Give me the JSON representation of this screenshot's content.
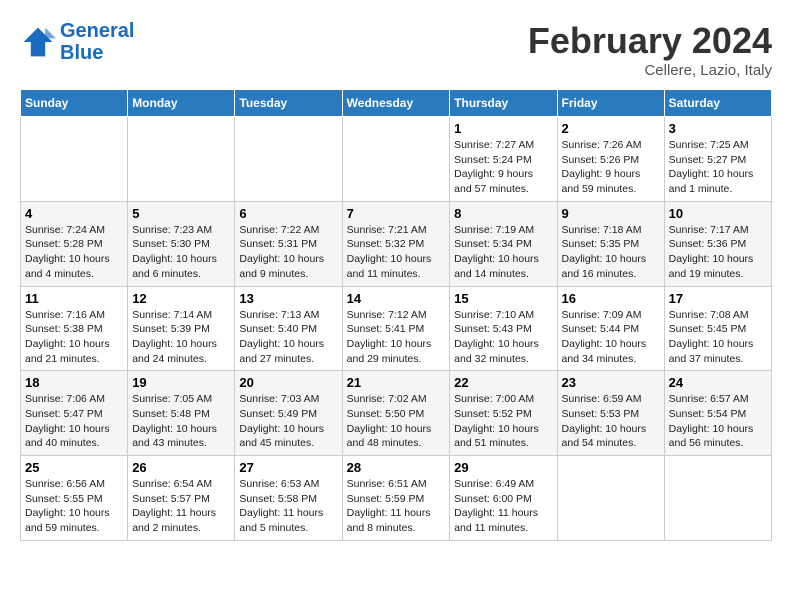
{
  "header": {
    "logo_line1": "General",
    "logo_line2": "Blue",
    "month": "February 2024",
    "location": "Cellere, Lazio, Italy"
  },
  "weekdays": [
    "Sunday",
    "Monday",
    "Tuesday",
    "Wednesday",
    "Thursday",
    "Friday",
    "Saturday"
  ],
  "weeks": [
    [
      {
        "day": "",
        "info": ""
      },
      {
        "day": "",
        "info": ""
      },
      {
        "day": "",
        "info": ""
      },
      {
        "day": "",
        "info": ""
      },
      {
        "day": "1",
        "info": "Sunrise: 7:27 AM\nSunset: 5:24 PM\nDaylight: 9 hours and 57 minutes."
      },
      {
        "day": "2",
        "info": "Sunrise: 7:26 AM\nSunset: 5:26 PM\nDaylight: 9 hours and 59 minutes."
      },
      {
        "day": "3",
        "info": "Sunrise: 7:25 AM\nSunset: 5:27 PM\nDaylight: 10 hours and 1 minute."
      }
    ],
    [
      {
        "day": "4",
        "info": "Sunrise: 7:24 AM\nSunset: 5:28 PM\nDaylight: 10 hours and 4 minutes."
      },
      {
        "day": "5",
        "info": "Sunrise: 7:23 AM\nSunset: 5:30 PM\nDaylight: 10 hours and 6 minutes."
      },
      {
        "day": "6",
        "info": "Sunrise: 7:22 AM\nSunset: 5:31 PM\nDaylight: 10 hours and 9 minutes."
      },
      {
        "day": "7",
        "info": "Sunrise: 7:21 AM\nSunset: 5:32 PM\nDaylight: 10 hours and 11 minutes."
      },
      {
        "day": "8",
        "info": "Sunrise: 7:19 AM\nSunset: 5:34 PM\nDaylight: 10 hours and 14 minutes."
      },
      {
        "day": "9",
        "info": "Sunrise: 7:18 AM\nSunset: 5:35 PM\nDaylight: 10 hours and 16 minutes."
      },
      {
        "day": "10",
        "info": "Sunrise: 7:17 AM\nSunset: 5:36 PM\nDaylight: 10 hours and 19 minutes."
      }
    ],
    [
      {
        "day": "11",
        "info": "Sunrise: 7:16 AM\nSunset: 5:38 PM\nDaylight: 10 hours and 21 minutes."
      },
      {
        "day": "12",
        "info": "Sunrise: 7:14 AM\nSunset: 5:39 PM\nDaylight: 10 hours and 24 minutes."
      },
      {
        "day": "13",
        "info": "Sunrise: 7:13 AM\nSunset: 5:40 PM\nDaylight: 10 hours and 27 minutes."
      },
      {
        "day": "14",
        "info": "Sunrise: 7:12 AM\nSunset: 5:41 PM\nDaylight: 10 hours and 29 minutes."
      },
      {
        "day": "15",
        "info": "Sunrise: 7:10 AM\nSunset: 5:43 PM\nDaylight: 10 hours and 32 minutes."
      },
      {
        "day": "16",
        "info": "Sunrise: 7:09 AM\nSunset: 5:44 PM\nDaylight: 10 hours and 34 minutes."
      },
      {
        "day": "17",
        "info": "Sunrise: 7:08 AM\nSunset: 5:45 PM\nDaylight: 10 hours and 37 minutes."
      }
    ],
    [
      {
        "day": "18",
        "info": "Sunrise: 7:06 AM\nSunset: 5:47 PM\nDaylight: 10 hours and 40 minutes."
      },
      {
        "day": "19",
        "info": "Sunrise: 7:05 AM\nSunset: 5:48 PM\nDaylight: 10 hours and 43 minutes."
      },
      {
        "day": "20",
        "info": "Sunrise: 7:03 AM\nSunset: 5:49 PM\nDaylight: 10 hours and 45 minutes."
      },
      {
        "day": "21",
        "info": "Sunrise: 7:02 AM\nSunset: 5:50 PM\nDaylight: 10 hours and 48 minutes."
      },
      {
        "day": "22",
        "info": "Sunrise: 7:00 AM\nSunset: 5:52 PM\nDaylight: 10 hours and 51 minutes."
      },
      {
        "day": "23",
        "info": "Sunrise: 6:59 AM\nSunset: 5:53 PM\nDaylight: 10 hours and 54 minutes."
      },
      {
        "day": "24",
        "info": "Sunrise: 6:57 AM\nSunset: 5:54 PM\nDaylight: 10 hours and 56 minutes."
      }
    ],
    [
      {
        "day": "25",
        "info": "Sunrise: 6:56 AM\nSunset: 5:55 PM\nDaylight: 10 hours and 59 minutes."
      },
      {
        "day": "26",
        "info": "Sunrise: 6:54 AM\nSunset: 5:57 PM\nDaylight: 11 hours and 2 minutes."
      },
      {
        "day": "27",
        "info": "Sunrise: 6:53 AM\nSunset: 5:58 PM\nDaylight: 11 hours and 5 minutes."
      },
      {
        "day": "28",
        "info": "Sunrise: 6:51 AM\nSunset: 5:59 PM\nDaylight: 11 hours and 8 minutes."
      },
      {
        "day": "29",
        "info": "Sunrise: 6:49 AM\nSunset: 6:00 PM\nDaylight: 11 hours and 11 minutes."
      },
      {
        "day": "",
        "info": ""
      },
      {
        "day": "",
        "info": ""
      }
    ]
  ]
}
